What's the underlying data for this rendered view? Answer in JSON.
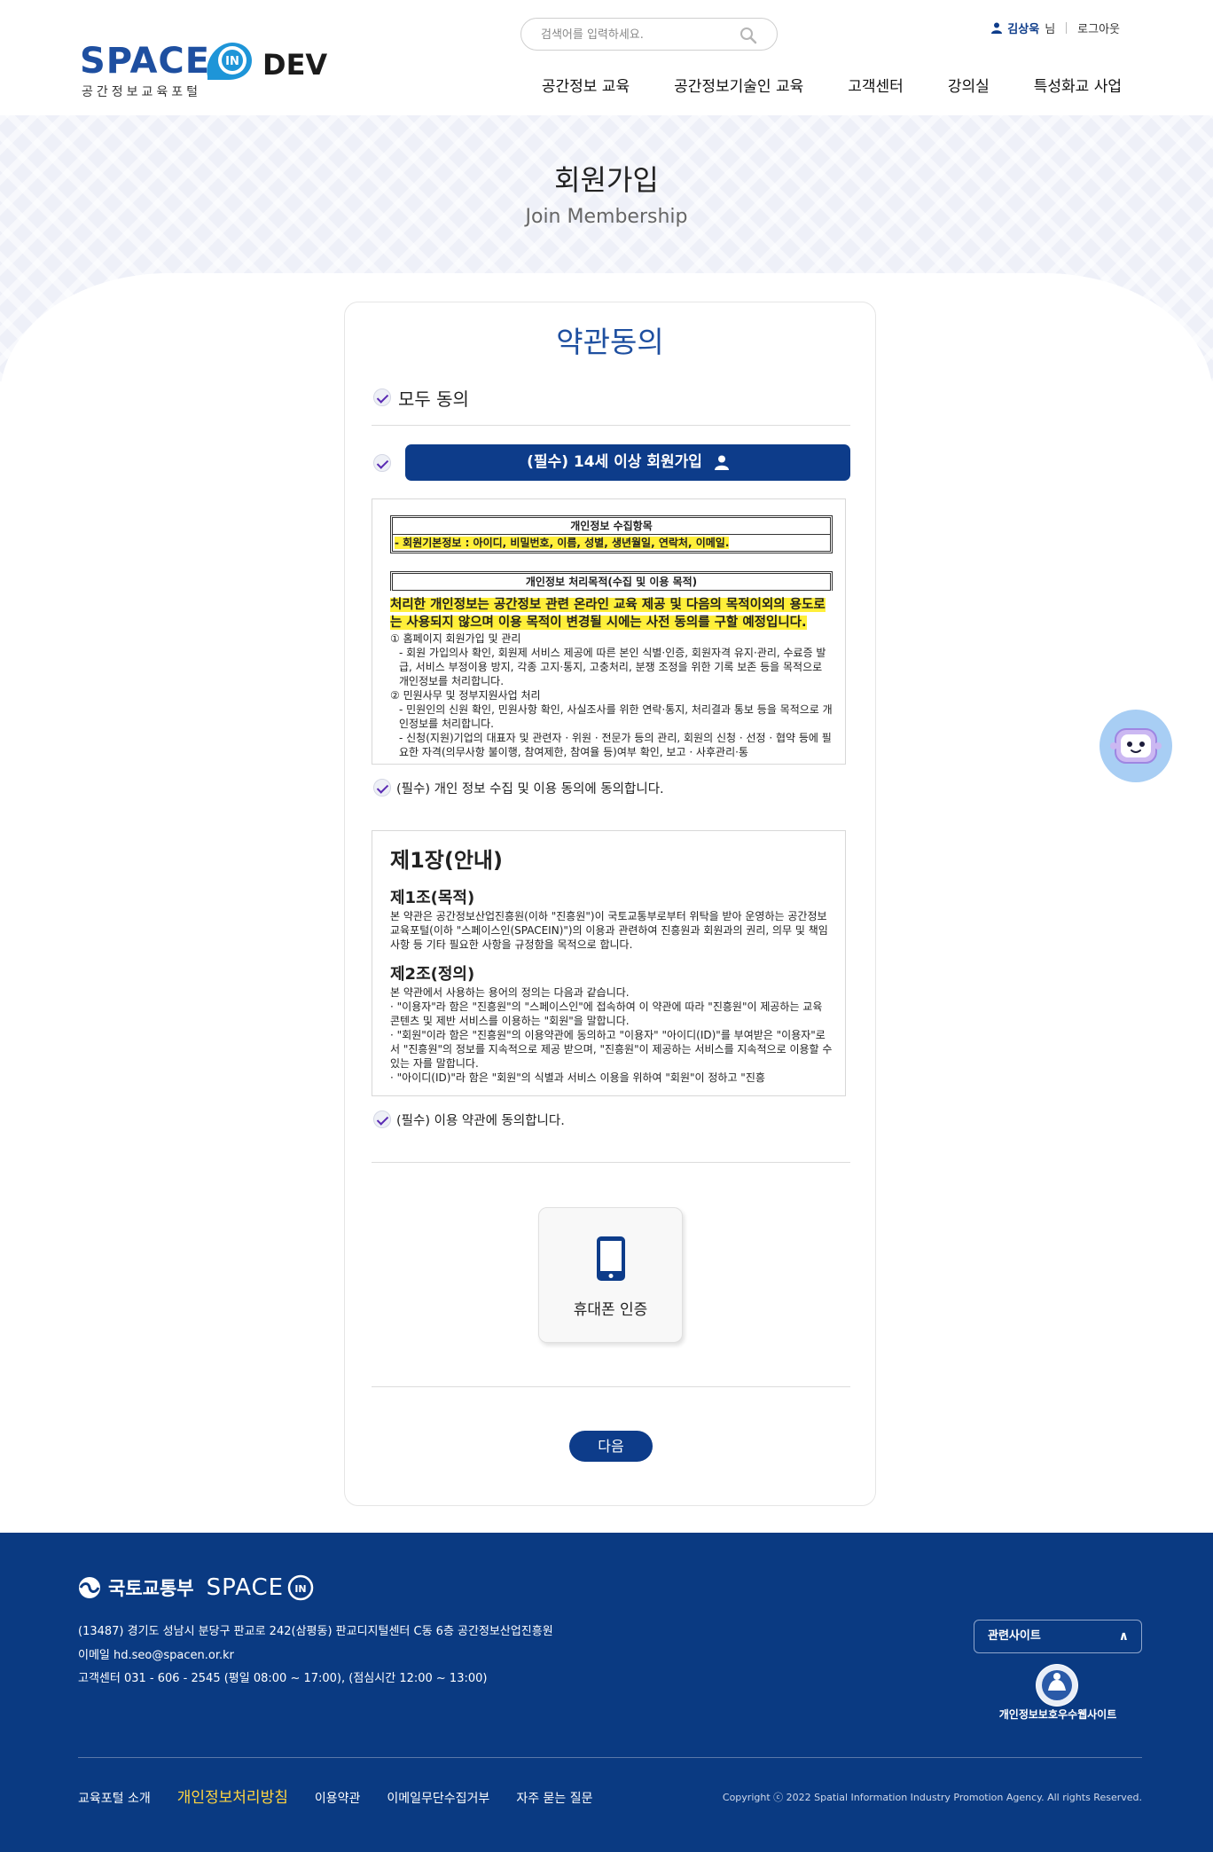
{
  "header": {
    "logo_space": "SPACE",
    "logo_in": "IN",
    "logo_dev": "DEV",
    "logo_sub": "공간정보교육포털",
    "search_placeholder": "검색어를 입력하세요.",
    "user_name": "김상욱",
    "user_suffix": "님",
    "logout": "로그아웃",
    "nav": [
      "공간정보 교육",
      "공간정보기술인 교육",
      "고객센터",
      "강의실",
      "특성화교 사업"
    ]
  },
  "hero": {
    "title": "회원가입",
    "subtitle": "Join Membership"
  },
  "card": {
    "title": "약관동의",
    "agree_all": "모두 동의",
    "join_button": "(필수) 14세 이상 회원가입",
    "privacy": {
      "table1_header": "개인정보 수집항목",
      "table1_row": "- 회원기본정보 : 아이디, 비밀번호, 이름, 성별, 생년월일, 연락처, 이메일.",
      "table2_header": "개인정보 처리목적(수집 및 이용 목적)",
      "highlight": "처리한 개인정보는 공간정보 관련 온라인 교육 제공 및 다음의 목적이외의 용도로는 사용되지 않으며 이용 목적이 변경될 시에는 사전 동의를 구할 예정입니다.",
      "lines": [
        "① 홈페이지 회원가입 및 관리",
        "   - 회원 가입의사 확인, 회원제 서비스 제공에 따른 본인 식별·인증, 회원자격 유지·관리, 수료증 발급, 서비스 부정이용 방지, 각종 고지·통지, 고충처리, 분쟁 조정을 위한 기록 보존 등을 목적으로 개인정보를 처리합니다.",
        "② 민원사무 및 정부지원사업 처리",
        "   - 민원인의 신원 확인, 민원사항 확인, 사실조사를 위한 연락·통지, 처리결과 통보 등을 목적으로 개인정보를 처리합니다.",
        "   - 신청(지원)기업의 대표자 및 관련자 · 위원 · 전문가 등의 관리, 회원의 신청 · 선정 · 협약 등에 필요한 자격(의무사항 불이행, 참여제한, 참여율 등)여부 확인, 보고 · 사후관리·통"
      ],
      "agree": "(필수) 개인 정보 수집 및 이용 동의에 동의합니다."
    },
    "terms": {
      "chapter": "제1장(안내)",
      "art1_title": "제1조(목적)",
      "art1_body": "본 약관은 공간정보산업진흥원(이하 \"진흥원\")이 국토교통부로부터 위탁을 받아 운영하는 공간정보 교육포털(이하 \"스페이스인(SPACEIN)\")의 이용과 관련하여 진흥원과 회원과의 권리, 의무 및 책임사항 등 기타 필요한 사항을 규정함을 목적으로 합니다.",
      "art2_title": "제2조(정의)",
      "art2_lines": [
        "본 약관에서 사용하는 용어의 정의는 다음과 같습니다.",
        "· \"이용자\"라 함은 \"진흥원\"의 \"스페이스인\"에 접속하여 이 약관에 따라 \"진흥원\"이 제공하는 교육 콘텐츠 및 제반 서비스를 이용하는 \"회원\"을 말합니다.",
        "· \"회원\"이라 함은 \"진흥원\"의 이용약관에 동의하고 \"이용자\" \"아이디(ID)\"를 부여받은 \"이용자\"로서 \"진흥원\"의 정보를 지속적으로 제공 받으며, \"진흥원\"이 제공하는 서비스를 지속적으로 이용할 수 있는 자를 말합니다.",
        "· \"아이디(ID)\"라 함은 \"회원\"의 식별과 서비스 이용을 위하여 \"회원\"이 정하고 \"진흥"
      ],
      "agree": "(필수) 이용 약관에 동의합니다."
    },
    "phone_auth": "휴대폰 인증",
    "next": "다음"
  },
  "footer": {
    "ministry": "국토교통부",
    "space": "SPACE",
    "in": "IN",
    "address": "(13487) 경기도 성남시 분당구 판교로 242(삼평동) 판교디지털센터 C동 6층 공간정보산업진흥원",
    "email": "이메일 hd.seo@spacen.or.kr",
    "contact": "고객센터 031 - 606 - 2545 (평일 08:00 ~ 17:00), (점심시간 12:00 ~ 13:00)",
    "related_sites": "관련사이트",
    "privacy_site": "개인정보보호우수웹사이트",
    "nav": [
      "교육포털 소개",
      "개인정보처리방침",
      "이용약관",
      "이메일무단수집거부",
      "자주 묻는 질문"
    ],
    "copyright": "Copyright ⓒ 2022 Spatial Information Industry Promotion Agency. All rights Reserved."
  }
}
